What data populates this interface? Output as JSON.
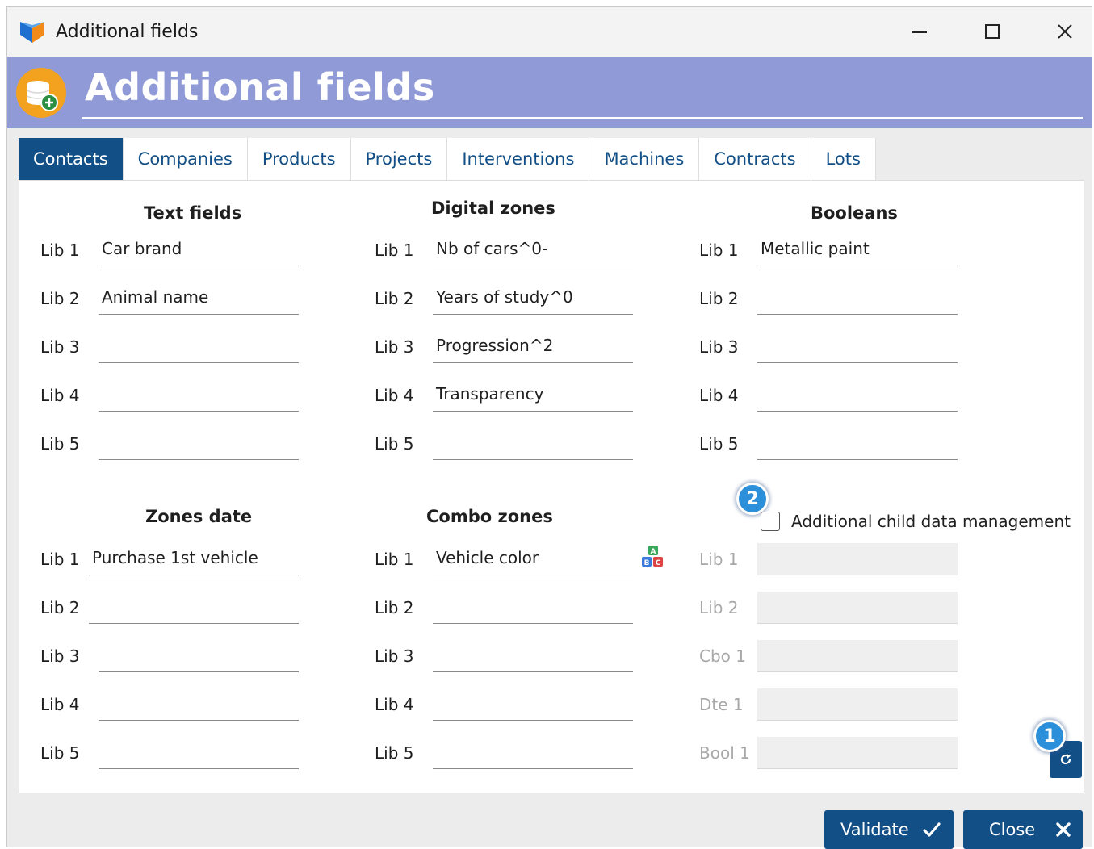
{
  "window": {
    "title": "Additional fields"
  },
  "header": {
    "title": "Additional fields"
  },
  "tabs": [
    "Contacts",
    "Companies",
    "Products",
    "Projects",
    "Interventions",
    "Machines",
    "Contracts",
    "Lots"
  ],
  "sections": {
    "text_fields": {
      "title": "Text fields",
      "rows": [
        {
          "label": "Lib 1",
          "value": "Car brand"
        },
        {
          "label": "Lib 2",
          "value": "Animal name"
        },
        {
          "label": "Lib 3",
          "value": ""
        },
        {
          "label": "Lib 4",
          "value": ""
        },
        {
          "label": "Lib 5",
          "value": ""
        }
      ]
    },
    "digital_zones": {
      "title": "Digital zones",
      "rows": [
        {
          "label": "Lib 1",
          "value": "Nb of cars^0-"
        },
        {
          "label": "Lib 2",
          "value": "Years of study^0"
        },
        {
          "label": "Lib 3",
          "value": "Progression^2"
        },
        {
          "label": "Lib 4",
          "value": "Transparency"
        },
        {
          "label": "Lib 5",
          "value": ""
        }
      ]
    },
    "booleans": {
      "title": "Booleans",
      "rows": [
        {
          "label": "Lib 1",
          "value": "Metallic paint"
        },
        {
          "label": "Lib 2",
          "value": ""
        },
        {
          "label": "Lib 3",
          "value": ""
        },
        {
          "label": "Lib 4",
          "value": ""
        },
        {
          "label": "Lib 5",
          "value": ""
        }
      ]
    },
    "zones_date": {
      "title": "Zones date",
      "rows": [
        {
          "label": "Lib 1",
          "value": "Purchase 1st vehicle"
        },
        {
          "label": "Lib 2",
          "value": ""
        },
        {
          "label": "Lib 3",
          "value": ""
        },
        {
          "label": "Lib 4",
          "value": ""
        },
        {
          "label": "Lib 5",
          "value": ""
        }
      ]
    },
    "combo_zones": {
      "title": "Combo zones",
      "rows": [
        {
          "label": "Lib 1",
          "value": "Vehicle color"
        },
        {
          "label": "Lib 2",
          "value": ""
        },
        {
          "label": "Lib 3",
          "value": ""
        },
        {
          "label": "Lib 4",
          "value": ""
        },
        {
          "label": "Lib 5",
          "value": ""
        }
      ]
    },
    "child_data": {
      "checkbox_label": "Additional child data management",
      "checked": false,
      "rows": [
        {
          "label": "Lib 1",
          "value": ""
        },
        {
          "label": "Lib 2",
          "value": ""
        },
        {
          "label": "Cbo 1",
          "value": ""
        },
        {
          "label": "Dte 1",
          "value": ""
        },
        {
          "label": "Bool 1",
          "value": ""
        }
      ]
    }
  },
  "badges": {
    "refresh": "1",
    "child_data": "2"
  },
  "footer": {
    "validate_label": "Validate",
    "close_label": "Close"
  },
  "colors": {
    "accent": "#124f87",
    "header_bg": "#8f9ad6",
    "badge": "#2b8fd9"
  },
  "icons": {
    "app": "app-logo-icon",
    "header": "database-add-icon",
    "combo": "abc-blocks-icon",
    "refresh": "refresh-icon"
  }
}
